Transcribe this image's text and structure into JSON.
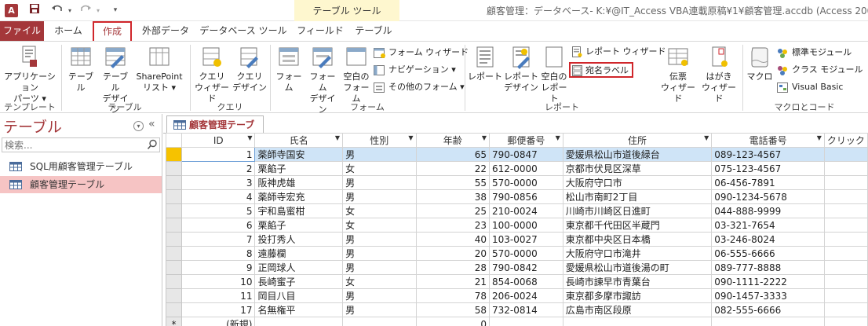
{
  "title_bar": {
    "app_icon": "A",
    "qat_save_icon": "save-icon",
    "qat_undo_icon": "undo-icon",
    "qat_redo_icon": "redo-icon",
    "qat_customize_icon": "customize-icon",
    "context_title": "テーブル ツール",
    "window_title": "顧客管理：データベース- K:¥@IT_Access VBA連載原稿¥1¥顧客管理.accdb (Access 200"
  },
  "tabs": [
    "ファイル",
    "ホーム",
    "作成",
    "外部データ",
    "データベース ツール",
    "フィールド",
    "テーブル"
  ],
  "ribbon": {
    "template_group": {
      "label": "テンプレート",
      "app_parts": "アプリケーション\nパーツ ▾"
    },
    "table_group": {
      "label": "テーブル",
      "table": "テーブル",
      "table_design": "テーブル\nデザイン",
      "sharepoint": "SharePoint\nリスト ▾"
    },
    "query_group": {
      "label": "クエリ",
      "query_wizard": "クエリ\nウィザード",
      "query_design": "クエリ\nデザイン"
    },
    "form_group": {
      "label": "フォーム",
      "form": "フォーム",
      "form_design": "フォーム\nデザイン",
      "blank_form": "空白の\nフォーム",
      "form_wizard": "フォーム ウィザード",
      "navigation": "ナビゲーション ▾",
      "more_forms": "その他のフォーム ▾"
    },
    "report_group": {
      "label": "レポート",
      "report": "レポート",
      "report_design": "レポート\nデザイン",
      "blank_report": "空白の\nレポート",
      "report_wizard": "レポート ウィザード",
      "labels": "宛名ラベル"
    },
    "macro_group": {
      "label": "マクロとコード",
      "macro": "マクロ",
      "module": "標準モジュール",
      "class_module": "クラス モジュール",
      "visual_basic": "Visual Basic"
    },
    "postcard_group": {
      "slip_wizard": "伝票\nウィザード",
      "postcard_wizard": "はがき\nウィザード"
    }
  },
  "nav": {
    "title": "テーブル",
    "search_placeholder": "検索...",
    "items": [
      {
        "label": "SQL用顧客管理テーブル",
        "selected": false
      },
      {
        "label": "顧客管理テーブル",
        "selected": true
      }
    ]
  },
  "document": {
    "tab_label": "顧客管理テーブル",
    "columns": [
      "ID",
      "氏名",
      "性別",
      "年齢",
      "郵便番号",
      "住所",
      "電話番号",
      "クリック"
    ],
    "rows": [
      {
        "id": "1",
        "name": "薬師寺国安",
        "gender": "男",
        "age": "65",
        "zip": "790-0847",
        "address": "愛媛県松山市道後緑台",
        "phone": "089-123-4567"
      },
      {
        "id": "2",
        "name": "栗餡子",
        "gender": "女",
        "age": "22",
        "zip": "612-0000",
        "address": "京都市伏見区深草",
        "phone": "075-123-4567"
      },
      {
        "id": "3",
        "name": "阪神虎雄",
        "gender": "男",
        "age": "55",
        "zip": "570-0000",
        "address": "大阪府守口市",
        "phone": "06-456-7891"
      },
      {
        "id": "4",
        "name": "薬師寺宏充",
        "gender": "男",
        "age": "38",
        "zip": "790-0856",
        "address": "松山市南町2丁目",
        "phone": "090-1234-5678"
      },
      {
        "id": "5",
        "name": "宇和島蜜柑",
        "gender": "女",
        "age": "25",
        "zip": "210-0024",
        "address": "川崎市川崎区日進町",
        "phone": "044-888-9999"
      },
      {
        "id": "6",
        "name": "栗餡子",
        "gender": "女",
        "age": "23",
        "zip": "100-0000",
        "address": "東京都千代田区半蔵門",
        "phone": "03-321-7654"
      },
      {
        "id": "7",
        "name": "投打秀人",
        "gender": "男",
        "age": "40",
        "zip": "103-0027",
        "address": "東京都中央区日本橋",
        "phone": "03-246-8024"
      },
      {
        "id": "8",
        "name": "遠藤欄",
        "gender": "男",
        "age": "20",
        "zip": "570-0000",
        "address": "大阪府守口市滝井",
        "phone": "06-555-6666"
      },
      {
        "id": "9",
        "name": "正岡球人",
        "gender": "男",
        "age": "28",
        "zip": "790-0842",
        "address": "愛媛県松山市道後湯の町",
        "phone": "089-777-8888"
      },
      {
        "id": "10",
        "name": "長崎蜜子",
        "gender": "女",
        "age": "21",
        "zip": "854-0068",
        "address": "長崎市諫早市青葉台",
        "phone": "090-1111-2222"
      },
      {
        "id": "11",
        "name": "岡目八目",
        "gender": "男",
        "age": "78",
        "zip": "206-0024",
        "address": "東京都多摩市諏訪",
        "phone": "090-1457-3333"
      },
      {
        "id": "17",
        "name": "名無権平",
        "gender": "男",
        "age": "58",
        "zip": "732-0814",
        "address": "広島市南区段原",
        "phone": "082-555-6666"
      }
    ],
    "new_row_marker": "*",
    "new_row_label": "(新規)",
    "new_row_age": "0"
  }
}
